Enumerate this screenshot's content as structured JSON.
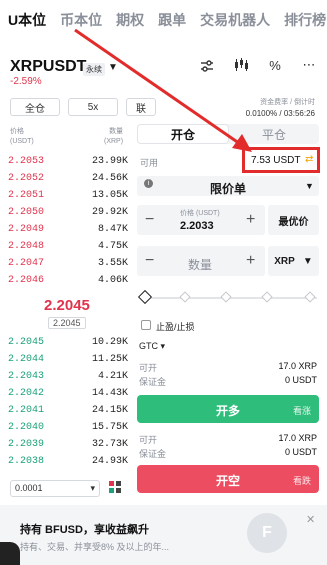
{
  "top_tabs": [
    "U本位",
    "币本位",
    "期权",
    "跟单",
    "交易机器人",
    "排行榜"
  ],
  "pair": {
    "name": "XRPUSDT",
    "badge": "永续",
    "change": "-2.59%"
  },
  "mode_buttons": [
    "全仓",
    "5x",
    "联"
  ],
  "funding": {
    "label": "资金费率 / 倒计时",
    "value": "0.0100% / 03:56:26"
  },
  "orderbook": {
    "price_header": "价格",
    "price_unit": "(USDT)",
    "qty_header": "数量",
    "qty_unit": "(XRP)",
    "asks": [
      {
        "price": "2.2053",
        "qty": "23.99K"
      },
      {
        "price": "2.2052",
        "qty": "24.56K"
      },
      {
        "price": "2.2051",
        "qty": "13.05K"
      },
      {
        "price": "2.2050",
        "qty": "29.92K"
      },
      {
        "price": "2.2049",
        "qty": "8.47K"
      },
      {
        "price": "2.2048",
        "qty": "4.75K"
      },
      {
        "price": "2.2047",
        "qty": "3.55K"
      },
      {
        "price": "2.2046",
        "qty": "4.06K"
      }
    ],
    "last_price": "2.2045",
    "mark_price": "2.2045",
    "bids": [
      {
        "price": "2.2045",
        "qty": "10.29K"
      },
      {
        "price": "2.2044",
        "qty": "11.25K"
      },
      {
        "price": "2.2043",
        "qty": "4.21K"
      },
      {
        "price": "2.2042",
        "qty": "14.43K"
      },
      {
        "price": "2.2041",
        "qty": "24.15K"
      },
      {
        "price": "2.2040",
        "qty": "15.75K"
      },
      {
        "price": "2.2039",
        "qty": "32.73K"
      },
      {
        "price": "2.2038",
        "qty": "24.93K"
      }
    ],
    "precision": "0.0001"
  },
  "panel": {
    "tab_open": "开仓",
    "tab_close": "平仓",
    "available_label": "可用",
    "available_value": "7.53 USDT",
    "order_type": "限价单",
    "price_label": "价格 (USDT)",
    "price_value": "2.2033",
    "bbo_label": "最优价",
    "qty_placeholder": "数量",
    "qty_unit": "XRP",
    "tpsl_label": "止盈/止损",
    "tif": "GTC",
    "long": {
      "open_label": "可开",
      "open_value": "17.0 XRP",
      "margin_label": "保证金",
      "margin_value": "0 USDT",
      "button": "开多",
      "sub": "看涨"
    },
    "short": {
      "open_label": "可开",
      "open_value": "17.0 XRP",
      "margin_label": "保证金",
      "margin_value": "0 USDT",
      "button": "开空",
      "sub": "看跌"
    }
  },
  "banner": {
    "title": "持有 BFUSD，享收益飙升",
    "subtitle": "持有、交易、并享受8% 及以上的年..."
  },
  "colors": {
    "red": "#e0344d",
    "green": "#1ba27a",
    "highlight": "#e22c2c",
    "long_btn": "#2ebd7a",
    "short_btn": "#ec4d61"
  }
}
